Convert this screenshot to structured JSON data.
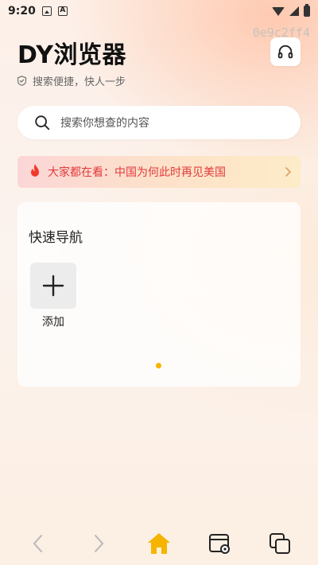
{
  "status_bar": {
    "time": "9:20"
  },
  "overlay": {
    "device_id": "0e9c2ff4"
  },
  "header": {
    "title": "DY浏览器",
    "tagline": "搜索便捷，快人一步"
  },
  "search": {
    "placeholder": "搜索你想查的内容"
  },
  "trending": {
    "prefix": "大家都在看：",
    "headline": "中国为何此时再见美国"
  },
  "quick_nav": {
    "title": "快速导航",
    "add_label": "添加"
  },
  "colors": {
    "accent": "#f5b400",
    "trending_text": "#e23a3a",
    "home_icon": "#f5b400"
  },
  "icons": {
    "headset": "headset-icon",
    "shield": "shield-check-icon",
    "search": "search-icon",
    "flame": "flame-icon",
    "chevron": "chevron-right-icon",
    "add": "plus-icon",
    "back": "back-arrow-icon",
    "forward": "forward-arrow-icon",
    "home": "home-icon",
    "bookmarks": "bookmarks-icon",
    "tabs": "tabs-icon"
  }
}
